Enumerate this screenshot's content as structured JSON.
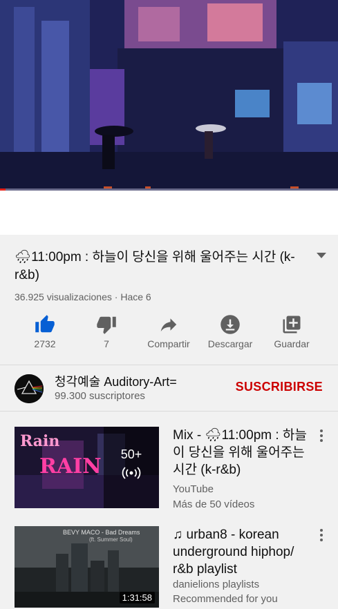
{
  "video": {
    "title": "🌧11:00pm : 하늘이 당신을 위해 울어주는 시간 (k-r&b)",
    "views": "36.925 visualizaciones",
    "time_ago": "Hace 6",
    "progress_fraction": 0.017
  },
  "actions": {
    "like_count": "2732",
    "dislike_count": "7",
    "share_label": "Compartir",
    "download_label": "Descargar",
    "save_label": "Guardar"
  },
  "channel": {
    "name": "청각예술 Auditory-Art=",
    "subscribers": "99.300 suscriptores",
    "subscribe_label": "SUSCRIBIRSE"
  },
  "recommendations": [
    {
      "title": "Mix - 🌧11:00pm : 하늘이 당신을 위해 울어주는 시간 (k-r&b)",
      "line1": "YouTube",
      "line2": "Más de 50 vídeos",
      "overlay_count": "50+",
      "thumb_text_1": "Rain",
      "thumb_text_2": "RAIN"
    },
    {
      "title": "♫ urban8 - korean underground hiphop/ r&b playlist",
      "line1": "danielions playlists",
      "line2": "Recommended for you",
      "duration": "1:31:58",
      "thumb_caption": "BEVY MACO - Bad Dreams",
      "thumb_caption_2": "(ft. Summer Soul)"
    }
  ],
  "colors": {
    "accent": "#cc0000",
    "like_blue": "#065fd4",
    "progress_red": "#e62117"
  }
}
